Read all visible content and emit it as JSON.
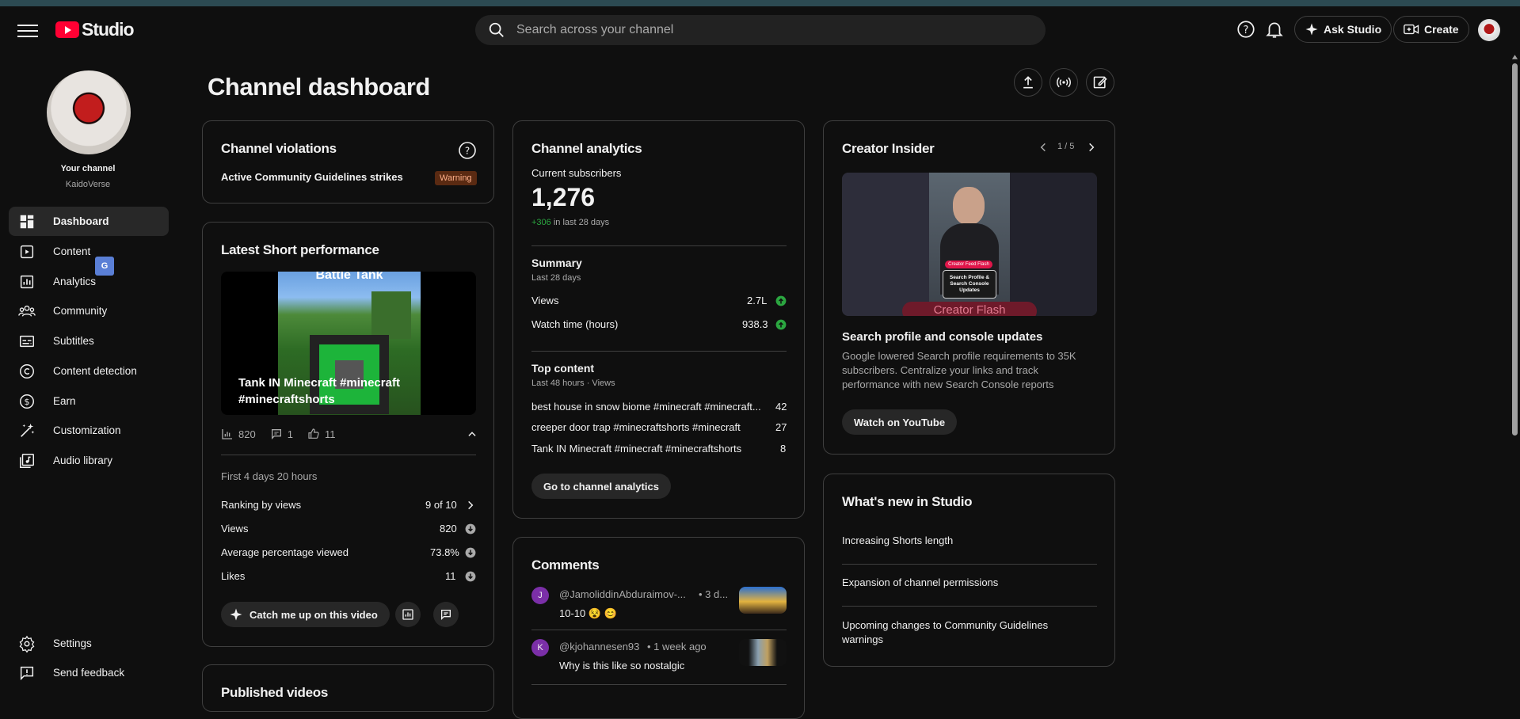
{
  "header": {
    "logo_text": "Studio",
    "search_placeholder": "Search across your channel",
    "ask_studio": "Ask Studio",
    "create": "Create"
  },
  "sidebar": {
    "channel_label": "Your channel",
    "channel_name": "KaidoVerse",
    "translate_glyph": "G",
    "items": [
      {
        "label": "Dashboard",
        "icon": "dashboard-icon"
      },
      {
        "label": "Content",
        "icon": "content-icon"
      },
      {
        "label": "Analytics",
        "icon": "analytics-icon"
      },
      {
        "label": "Community",
        "icon": "community-icon"
      },
      {
        "label": "Subtitles",
        "icon": "subtitles-icon"
      },
      {
        "label": "Content detection",
        "icon": "copyright-icon"
      },
      {
        "label": "Earn",
        "icon": "dollar-icon"
      },
      {
        "label": "Customization",
        "icon": "wand-icon"
      },
      {
        "label": "Audio library",
        "icon": "audio-library-icon"
      }
    ],
    "bottom": [
      {
        "label": "Settings",
        "icon": "gear-icon"
      },
      {
        "label": "Send feedback",
        "icon": "feedback-icon"
      }
    ]
  },
  "page": {
    "title": "Channel dashboard"
  },
  "violations": {
    "title": "Channel violations",
    "row_label": "Active Community Guidelines strikes",
    "badge": "Warning"
  },
  "short_perf": {
    "title": "Latest Short performance",
    "thumb_top_text": "Battle Tank",
    "thumb_caption": "Tank IN Minecraft #minecraft #minecraftshorts",
    "stat_views": "820",
    "stat_comments": "1",
    "stat_likes": "11",
    "period": "First 4 days 20 hours",
    "rows": [
      {
        "label": "Ranking by views",
        "value": "9 of 10"
      },
      {
        "label": "Views",
        "value": "820"
      },
      {
        "label": "Average percentage viewed",
        "value": "73.8%"
      },
      {
        "label": "Likes",
        "value": "11"
      }
    ],
    "catch_up": "Catch me up on this video"
  },
  "published": {
    "title": "Published videos"
  },
  "analytics": {
    "title": "Channel analytics",
    "subs_label": "Current subscribers",
    "subs_value": "1,276",
    "subs_delta": "+306",
    "subs_delta_suffix": " in last 28 days",
    "summary_title": "Summary",
    "summary_period": "Last 28 days",
    "summary_rows": [
      {
        "label": "Views",
        "value": "2.7L"
      },
      {
        "label": "Watch time (hours)",
        "value": "938.3"
      }
    ],
    "top_title": "Top content",
    "top_period": "Last 48 hours · Views",
    "top_rows": [
      {
        "label": "best house in snow biome #minecraft #minecraft...",
        "value": "42"
      },
      {
        "label": "creeper door trap #minecraftshorts #minecraft",
        "value": "27"
      },
      {
        "label": "Tank IN Minecraft #minecraft #minecraftshorts",
        "value": "8"
      }
    ],
    "button": "Go to channel analytics"
  },
  "comments": {
    "title": "Comments",
    "items": [
      {
        "initial": "J",
        "author": "@JamoliddinAbduraimov-...",
        "time": "• 3 d...",
        "text": "10-10 😵 😊"
      },
      {
        "initial": "K",
        "author": "@kjohannesen93",
        "time": "• 1 week ago",
        "text": "Why is this like so nostalgic"
      }
    ]
  },
  "insider": {
    "title": "Creator Insider",
    "pager": "1 / 5",
    "thumb_label": "Creator Feed Flash",
    "thumb_card": "Search Profile & Search Console Updates",
    "thumb_under": "Creator Flash",
    "video_title": "Search profile and console updates",
    "desc": "Google lowered Search profile requirements to 35K subscribers. Centralize your links and track performance with new Search Console reports",
    "button": "Watch on YouTube"
  },
  "whats_new": {
    "title": "What's new in Studio",
    "items": [
      "Increasing Shorts length",
      "Expansion of channel permissions",
      "Upcoming changes to Community Guidelines warnings"
    ]
  },
  "colors": {
    "accent_red": "#ff0033",
    "up_green": "#2ba640",
    "badge_bg": "#5a2a12"
  }
}
